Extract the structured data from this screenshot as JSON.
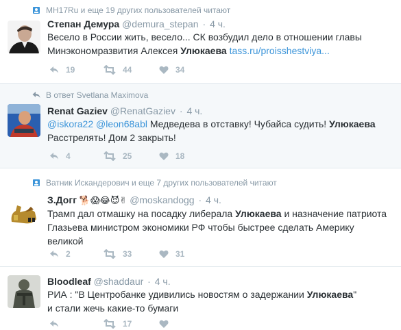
{
  "tweets": [
    {
      "context": "MH17Ru и еще 19 других пользователей читают",
      "fullname": "Степан Демура",
      "username": "@demura_stepan",
      "dot": "·",
      "time": "4 ч.",
      "text_line1": "Весело в России жить, весело... СК возбудил дело в отношении главы",
      "text_line2_a": "Минэкономразвития Алексея ",
      "text_line2_bold": "Улюкаева",
      "text_line2_link": "tass.ru/proisshestviya...",
      "replies": "19",
      "retweets": "44",
      "likes": "34"
    },
    {
      "context": "В ответ Svetlana Maximova",
      "fullname": "Renat Gaziev",
      "username": "@RenatGaziev",
      "dot": "·",
      "time": "4 ч.",
      "mention1": "@iskora22",
      "mention2": "@leon68abl",
      "text_line1_a": "Медведева в отставку! Чубайса судить! ",
      "text_line1_bold": "Улюкаева",
      "text_line2": "Расстрелять! Дом 2 закрыть!",
      "replies": "4",
      "retweets": "25",
      "likes": "18"
    },
    {
      "context": "Ватник Искандерович и еще 7 других пользователей читают",
      "fullname": "З.Догг",
      "emojis": "🐕😱😂😈✌",
      "username": "@moskandogg",
      "dot": "·",
      "time": "4 ч.",
      "text_line1_a": "Трамп дал отмашку на посадку либерала ",
      "text_line1_bold": "Улюкаева",
      "text_line1_b": " и назначение патриота",
      "text_line2": "Глазьева министром экономики РФ чтобы быстрее сделать Америку",
      "text_line3": "великой",
      "replies": "2",
      "retweets": "33",
      "likes": "31"
    },
    {
      "fullname": "Bloodleaf",
      "username": "@shaddaur",
      "dot": "·",
      "time": "4 ч.",
      "text_line1_a": "РИА : \"В Центробанке удивились новостям о задержании ",
      "text_line1_bold": "Улюкаева",
      "text_line1_b": "\"",
      "text_line2": "и стали жечь какие-то бумаги",
      "replies": "",
      "retweets": "17",
      "likes": ""
    }
  ],
  "colors": {
    "accent": "#3b94d9",
    "muted": "#8899a6",
    "action": "#aab8c2",
    "highlight_bg": "#f5f8fa",
    "divider": "#e1e8ed"
  },
  "icons": {
    "follow": "person-follow-icon",
    "reply_context": "reply-arrow-icon",
    "reply": "reply-icon",
    "retweet": "retweet-icon",
    "like": "heart-icon"
  }
}
